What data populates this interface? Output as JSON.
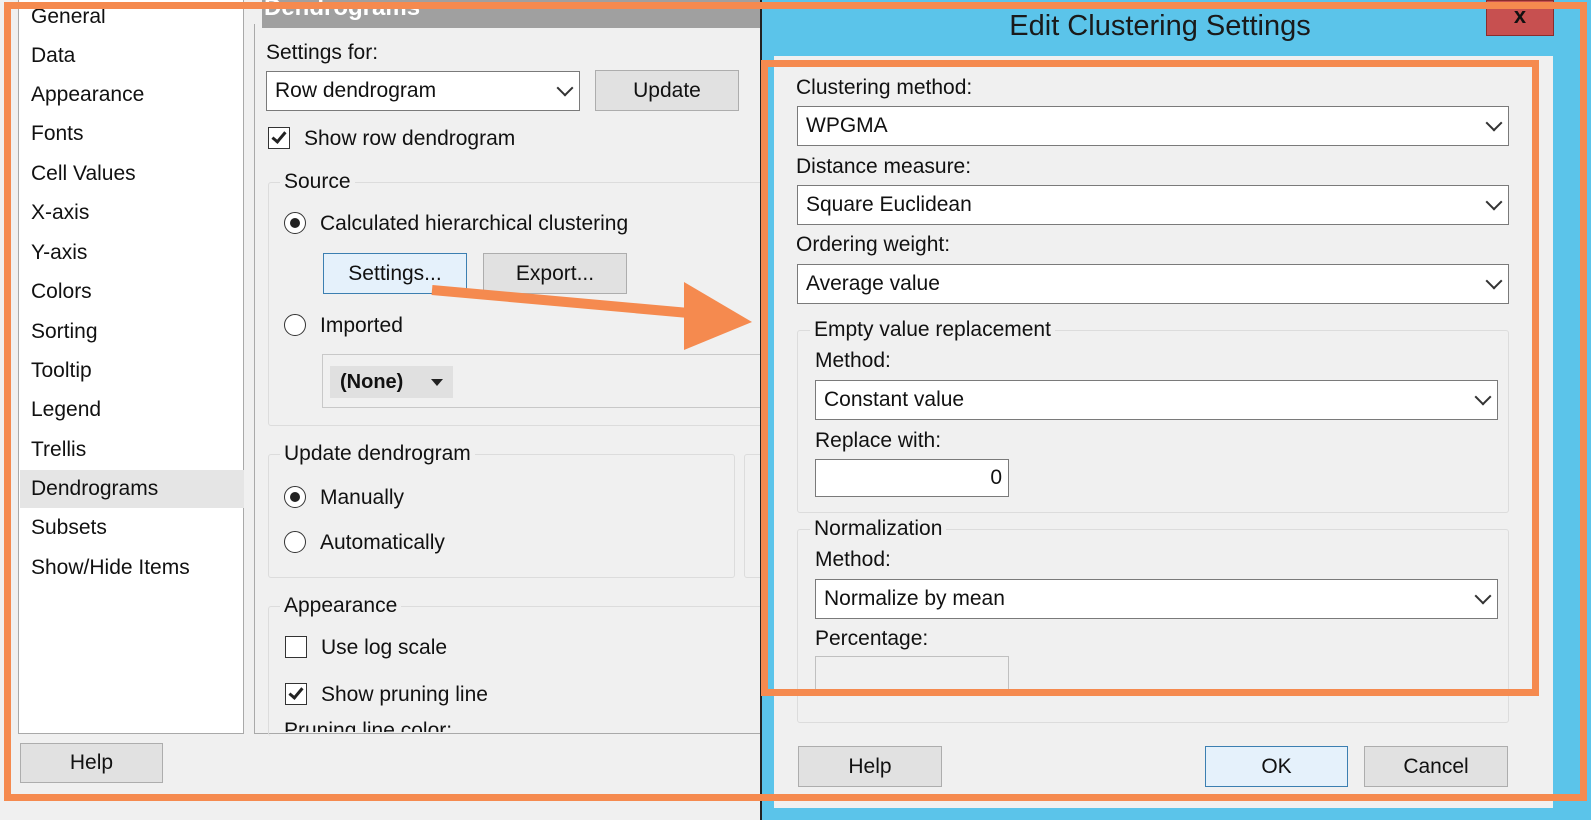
{
  "nav": {
    "items": [
      {
        "label": "General"
      },
      {
        "label": "Data"
      },
      {
        "label": "Appearance"
      },
      {
        "label": "Fonts"
      },
      {
        "label": "Cell Values"
      },
      {
        "label": "X-axis"
      },
      {
        "label": "Y-axis"
      },
      {
        "label": "Colors"
      },
      {
        "label": "Sorting"
      },
      {
        "label": "Tooltip"
      },
      {
        "label": "Legend"
      },
      {
        "label": "Trellis"
      },
      {
        "label": "Dendrograms"
      },
      {
        "label": "Subsets"
      },
      {
        "label": "Show/Hide Items"
      }
    ],
    "selected": "Dendrograms",
    "help_label": "Help"
  },
  "page": {
    "title": "Dendrograms",
    "settings_for_label": "Settings for:",
    "settings_for_value": "Row dendrogram",
    "update_label": "Update",
    "show_dendrogram_label": "Show row dendrogram",
    "show_dendrogram_checked": true,
    "source": {
      "title": "Source",
      "calculated_label": "Calculated hierarchical clustering",
      "calculated_selected": true,
      "settings_button": "Settings...",
      "export_button": "Export...",
      "imported_label": "Imported",
      "imported_selected": false,
      "imported_value": "(None)"
    },
    "update_dendrogram": {
      "title": "Update dendrogram",
      "manually_label": "Manually",
      "manually_selected": true,
      "automatically_label": "Automatically",
      "automatically_selected": false
    },
    "appearance": {
      "title": "Appearance",
      "log_scale_label": "Use log scale",
      "log_scale_checked": false,
      "pruning_line_label": "Show pruning line",
      "pruning_line_checked": true,
      "pruning_color_label": "Pruning line color:"
    }
  },
  "dialog": {
    "title": "Edit Clustering Settings",
    "close_glyph": "x",
    "clustering_method_label": "Clustering method:",
    "clustering_method_value": "WPGMA",
    "distance_measure_label": "Distance measure:",
    "distance_measure_value": "Square Euclidean",
    "ordering_weight_label": "Ordering weight:",
    "ordering_weight_value": "Average value",
    "empty_value": {
      "title": "Empty value replacement",
      "method_label": "Method:",
      "method_value": "Constant value",
      "replace_with_label": "Replace with:",
      "replace_with_value": "0"
    },
    "normalization": {
      "title": "Normalization",
      "method_label": "Method:",
      "method_value": "Normalize by mean",
      "percentage_label": "Percentage:"
    },
    "help_button": "Help",
    "ok_button": "OK",
    "cancel_button": "Cancel"
  },
  "annotation_color": "#f58a4f"
}
